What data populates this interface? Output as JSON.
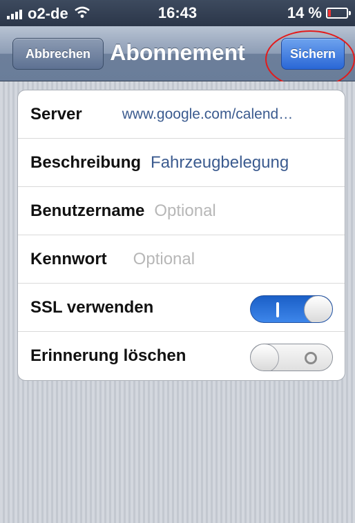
{
  "status_bar": {
    "carrier": "o2-de",
    "time": "16:43",
    "battery": "14 %",
    "battery_level": 0.14
  },
  "nav": {
    "title": "Abonnement",
    "cancel_label": "Abbrechen",
    "save_label": "Sichern"
  },
  "form": {
    "server": {
      "label": "Server",
      "value": "www.google.com/calend…"
    },
    "description": {
      "label": "Beschreibung",
      "value": "Fahrzeugbelegung"
    },
    "username": {
      "label": "Benutzername",
      "placeholder": "Optional"
    },
    "password": {
      "label": "Kennwort",
      "placeholder": "Optional"
    },
    "ssl": {
      "label": "SSL verwenden",
      "on": true
    },
    "delete_alarms": {
      "label": "Erinnerung löschen",
      "on": false
    }
  },
  "colors": {
    "nav_bar": "#7d8fa9",
    "save_button": "#3a79e0",
    "value_text": "#3b5b8f",
    "annotation_circle": "#e31b1b"
  }
}
